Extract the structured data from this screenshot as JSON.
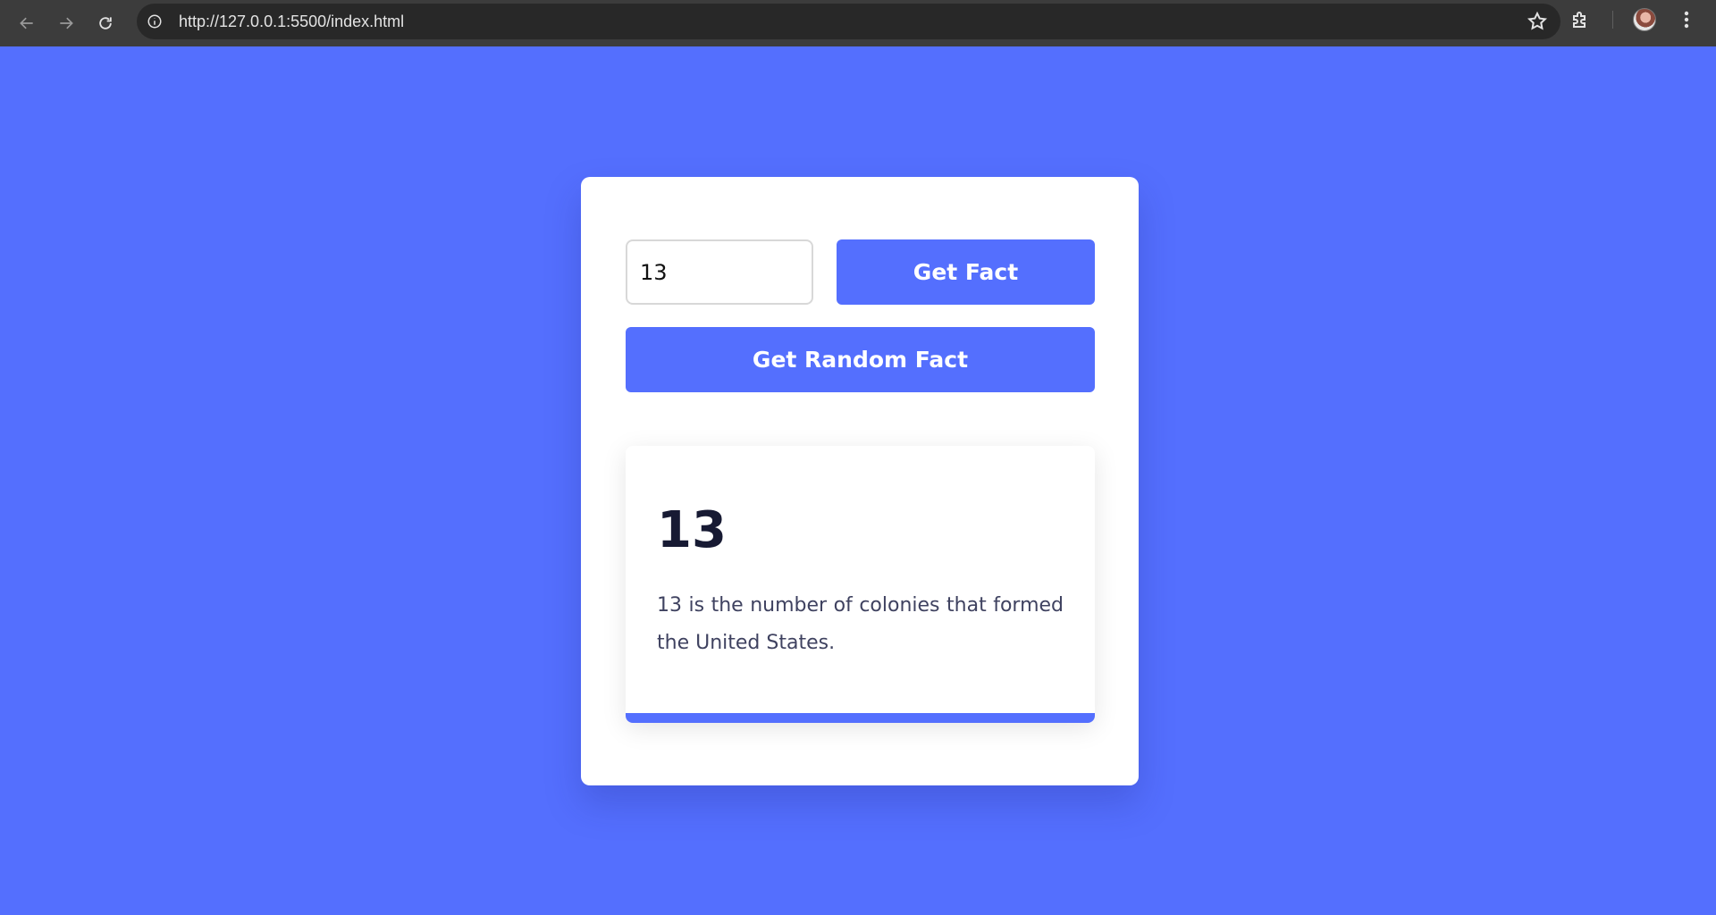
{
  "browser": {
    "url": "http://127.0.0.1:5500/index.html",
    "icons": [
      "back-arrow-icon",
      "forward-arrow-icon",
      "reload-icon",
      "site-info-icon",
      "star-icon",
      "extensions-icon",
      "avatar",
      "menu-dots-icon"
    ]
  },
  "form": {
    "number_value": "13",
    "get_fact_label": "Get Fact",
    "random_fact_label": "Get Random Fact"
  },
  "fact": {
    "number": "13",
    "text": "13 is the number of colonies that formed the United States."
  },
  "colors": {
    "page_background": "#546ffe",
    "accent": "#546ffe",
    "card": "#ffffff",
    "heading": "#171a33",
    "body_text": "#3f4260"
  }
}
